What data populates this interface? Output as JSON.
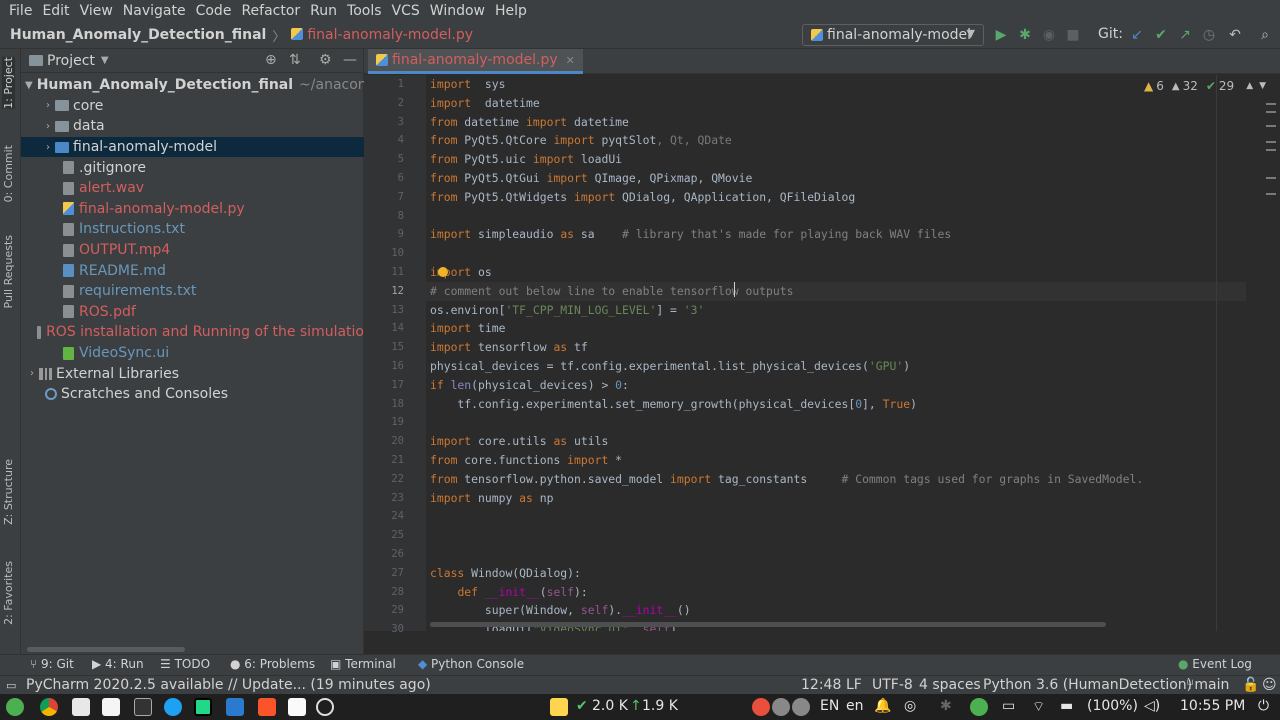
{
  "menu": [
    "File",
    "Edit",
    "View",
    "Navigate",
    "Code",
    "Refactor",
    "Run",
    "Tools",
    "VCS",
    "Window",
    "Help"
  ],
  "navbar": {
    "project": "Human_Anomaly_Detection_final",
    "file": "final-anomaly-model.py",
    "run_config": "final-anomaly-model",
    "git_label": "Git:"
  },
  "left_tabs": [
    "1: Project",
    "0: Commit",
    "Pull Requests",
    "Z: Structure",
    "2: Favorites"
  ],
  "project_panel": {
    "title": "Project",
    "root": "Human_Anomaly_Detection_final",
    "root_path": "~/anacond",
    "items": [
      {
        "label": "core",
        "kind": "folder"
      },
      {
        "label": "data",
        "kind": "folder"
      },
      {
        "label": "final-anomaly-model",
        "kind": "folder-blue"
      },
      {
        "label": ".gitignore",
        "kind": "file"
      },
      {
        "label": "alert.wav",
        "kind": "file"
      },
      {
        "label": "final-anomaly-model.py",
        "kind": "py"
      },
      {
        "label": "Instructions.txt",
        "kind": "file"
      },
      {
        "label": "OUTPUT.mp4",
        "kind": "file"
      },
      {
        "label": "README.md",
        "kind": "md"
      },
      {
        "label": "requirements.txt",
        "kind": "file"
      },
      {
        "label": "ROS.pdf",
        "kind": "file"
      },
      {
        "label": "ROS installation and Running of the simulatio",
        "kind": "file"
      },
      {
        "label": "VideoSync.ui",
        "kind": "ui"
      }
    ],
    "external": "External Libraries",
    "scratches": "Scratches and Consoles"
  },
  "editor": {
    "tab": "final-anomaly-model.py",
    "inspections": {
      "warnings": "6",
      "weak": "32",
      "typos": "29"
    },
    "line_numbers": [
      "1",
      "2",
      "3",
      "4",
      "5",
      "6",
      "7",
      "8",
      "9",
      "10",
      "11",
      "12",
      "13",
      "14",
      "15",
      "16",
      "17",
      "18",
      "19",
      "20",
      "21",
      "22",
      "23",
      "24",
      "25",
      "26",
      "27",
      "28",
      "29",
      "30"
    ]
  },
  "code_lines": [
    [
      [
        "kw",
        "import"
      ],
      [
        "",
        "  sys"
      ]
    ],
    [
      [
        "kw",
        "import"
      ],
      [
        "",
        "  datetime"
      ]
    ],
    [
      [
        "kw",
        "from"
      ],
      [
        "",
        " datetime "
      ],
      [
        "kw",
        "import"
      ],
      [
        "",
        " datetime"
      ]
    ],
    [
      [
        "kw",
        "from"
      ],
      [
        "",
        " PyQt5.QtCore "
      ],
      [
        "kw",
        "import"
      ],
      [
        "",
        " pyqtSlot"
      ],
      [
        "dim",
        ", Qt, QDate"
      ]
    ],
    [
      [
        "kw",
        "from"
      ],
      [
        "",
        " PyQt5.uic "
      ],
      [
        "kw",
        "import"
      ],
      [
        "",
        " loadUi"
      ]
    ],
    [
      [
        "kw",
        "from"
      ],
      [
        "",
        " PyQt5.QtGui "
      ],
      [
        "kw",
        "import"
      ],
      [
        "",
        " QImage, QPixmap, QMovie"
      ]
    ],
    [
      [
        "kw",
        "from"
      ],
      [
        "",
        " PyQt5.QtWidgets "
      ],
      [
        "kw",
        "import"
      ],
      [
        "",
        " QDialog, QApplication, QFileDialog"
      ]
    ],
    [],
    [
      [
        "kw",
        "import"
      ],
      [
        "",
        " simpleaudio "
      ],
      [
        "kw",
        "as"
      ],
      [
        "",
        " sa    "
      ],
      [
        "cm",
        "# library that's made for playing back WAV files"
      ]
    ],
    [],
    [
      [
        "kw",
        "import"
      ],
      [
        "",
        " os"
      ]
    ],
    [
      [
        "cm",
        "# comment out below line to enable tensorflow outputs"
      ]
    ],
    [
      [
        "",
        "os.environ["
      ],
      [
        "str",
        "'TF_CPP_MIN_LOG_LEVEL'"
      ],
      [
        "",
        "] = "
      ],
      [
        "str",
        "'3'"
      ]
    ],
    [
      [
        "kw",
        "import"
      ],
      [
        "",
        " time"
      ]
    ],
    [
      [
        "kw",
        "import"
      ],
      [
        "",
        " tensorflow "
      ],
      [
        "kw",
        "as"
      ],
      [
        "",
        " tf"
      ]
    ],
    [
      [
        "",
        "physical_devices = tf.config.experimental.list_physical_devices("
      ],
      [
        "str",
        "'GPU'"
      ],
      [
        "",
        ")"
      ]
    ],
    [
      [
        "kw",
        "if"
      ],
      [
        "",
        " "
      ],
      [
        "builtin",
        "len"
      ],
      [
        "",
        "(physical_devices) > "
      ],
      [
        "num",
        "0"
      ],
      [
        "",
        ":"
      ]
    ],
    [
      [
        "",
        "    tf.config.experimental.set_memory_growth(physical_devices["
      ],
      [
        "num",
        "0"
      ],
      [
        "",
        "], "
      ],
      [
        "kw",
        "True"
      ],
      [
        "",
        ")"
      ]
    ],
    [],
    [
      [
        "kw",
        "import"
      ],
      [
        "",
        " core.utils "
      ],
      [
        "kw",
        "as"
      ],
      [
        "",
        " utils"
      ]
    ],
    [
      [
        "kw",
        "from"
      ],
      [
        "",
        " core.functions "
      ],
      [
        "kw",
        "import"
      ],
      [
        "",
        " *"
      ]
    ],
    [
      [
        "kw",
        "from"
      ],
      [
        "",
        " tensorflow.python.saved_model "
      ],
      [
        "kw",
        "import"
      ],
      [
        "",
        " tag_constants     "
      ],
      [
        "cm",
        "# Common tags used for graphs in SavedModel."
      ]
    ],
    [
      [
        "kw",
        "import"
      ],
      [
        "",
        " numpy "
      ],
      [
        "kw",
        "as"
      ],
      [
        "",
        " np"
      ]
    ],
    [],
    [],
    [],
    [
      [
        "kw",
        "class"
      ],
      [
        "",
        " Window(QDialog):"
      ]
    ],
    [
      [
        "",
        "    "
      ],
      [
        "kw",
        "def"
      ],
      [
        "",
        " "
      ],
      [
        "dunder",
        "__init__"
      ],
      [
        "",
        "("
      ],
      [
        "self",
        "self"
      ],
      [
        "",
        "):"
      ]
    ],
    [
      [
        "",
        "        super(Window, "
      ],
      [
        "self",
        "self"
      ],
      [
        "",
        ")."
      ],
      [
        "dunder",
        "__init__"
      ],
      [
        "",
        "()"
      ]
    ],
    [
      [
        "",
        "        loadUi("
      ],
      [
        "str",
        "\"VideoSync.ui\""
      ],
      [
        "",
        ", "
      ],
      [
        "self",
        "self"
      ],
      [
        "",
        ")"
      ]
    ]
  ],
  "bottom_tools": [
    "9: Git",
    "4: Run",
    "TODO",
    "6: Problems",
    "Terminal",
    "Python Console",
    "Event Log"
  ],
  "status": {
    "message": "PyCharm 2020.2.5 available // Update... (19 minutes ago)",
    "position": "12:48",
    "line_sep": "LF",
    "encoding": "UTF-8",
    "indent": "4 spaces",
    "interpreter": "Python 3.6 (HumanDetection)",
    "branch": "main"
  },
  "taskbar": {
    "net_up": "2.0 K",
    "net_down": "1.9 K",
    "lang": "EN",
    "locale": "en",
    "battery": "(100%)",
    "time": "10:55 PM"
  }
}
